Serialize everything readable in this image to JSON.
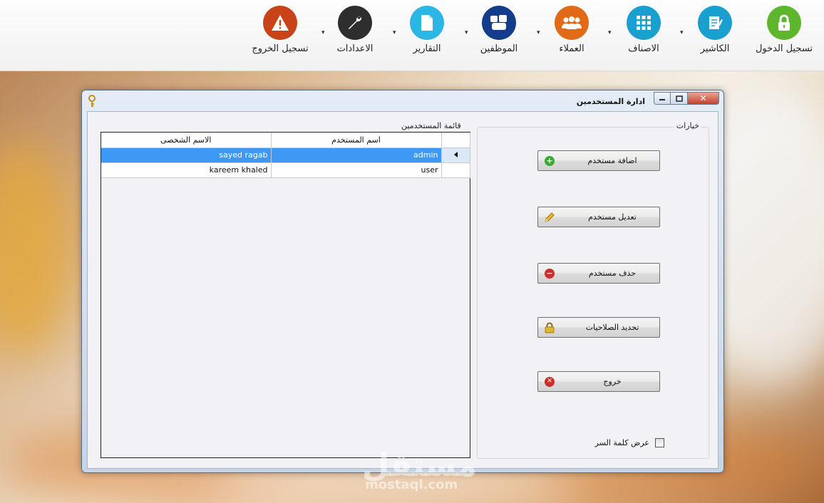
{
  "toolbar": {
    "items": [
      {
        "label": "تسجيل الدخول",
        "color": "#5db62c",
        "icon": "lock-icon"
      },
      {
        "label": "الكاشير",
        "color": "#1aa0cf",
        "icon": "notepad-icon"
      },
      {
        "label": "الاصناف",
        "color": "#1aa0cf",
        "icon": "grid-icon"
      },
      {
        "label": "العملاء",
        "color": "#e06a17",
        "icon": "users-group-icon"
      },
      {
        "label": "الموظفين",
        "color": "#133c8b",
        "icon": "employees-icon"
      },
      {
        "label": "التقارير",
        "color": "#2cb6e6",
        "icon": "document-icon"
      },
      {
        "label": "الاعدادات",
        "color": "#2e2e2e",
        "icon": "wrench-icon"
      },
      {
        "label": "تسجيل الخروج",
        "color": "#c84318",
        "icon": "warning-icon"
      }
    ],
    "dropdown_glyph": "▾"
  },
  "window": {
    "title": "ادارة المستخدمين",
    "close_glyph": "✕",
    "options_group": {
      "title": "خيارات",
      "buttons": [
        {
          "label": "اضافة مستخدم",
          "icon": "add-circle-icon"
        },
        {
          "label": "تعديل مستخدم",
          "icon": "pencil-icon"
        },
        {
          "label": "حذف مستخدم",
          "icon": "remove-circle-icon"
        },
        {
          "label": "تحديد الصلاحيات",
          "icon": "padlock-icon"
        },
        {
          "label": "خروج",
          "icon": "close-circle-icon"
        }
      ],
      "show_password": {
        "label": "عرض كلمة السر",
        "checked": false
      }
    },
    "users_list": {
      "title": "قائمة المستخدمين",
      "columns": [
        "اسم المستخدم",
        "الاسم الشخصى"
      ],
      "rows": [
        {
          "username": "admin",
          "fullname": "sayed ragab",
          "selected": true
        },
        {
          "username": "user",
          "fullname": "kareem khaled",
          "selected": false
        }
      ]
    }
  },
  "watermark": {
    "brand": "مستقل",
    "domain": "mostaql.com"
  }
}
